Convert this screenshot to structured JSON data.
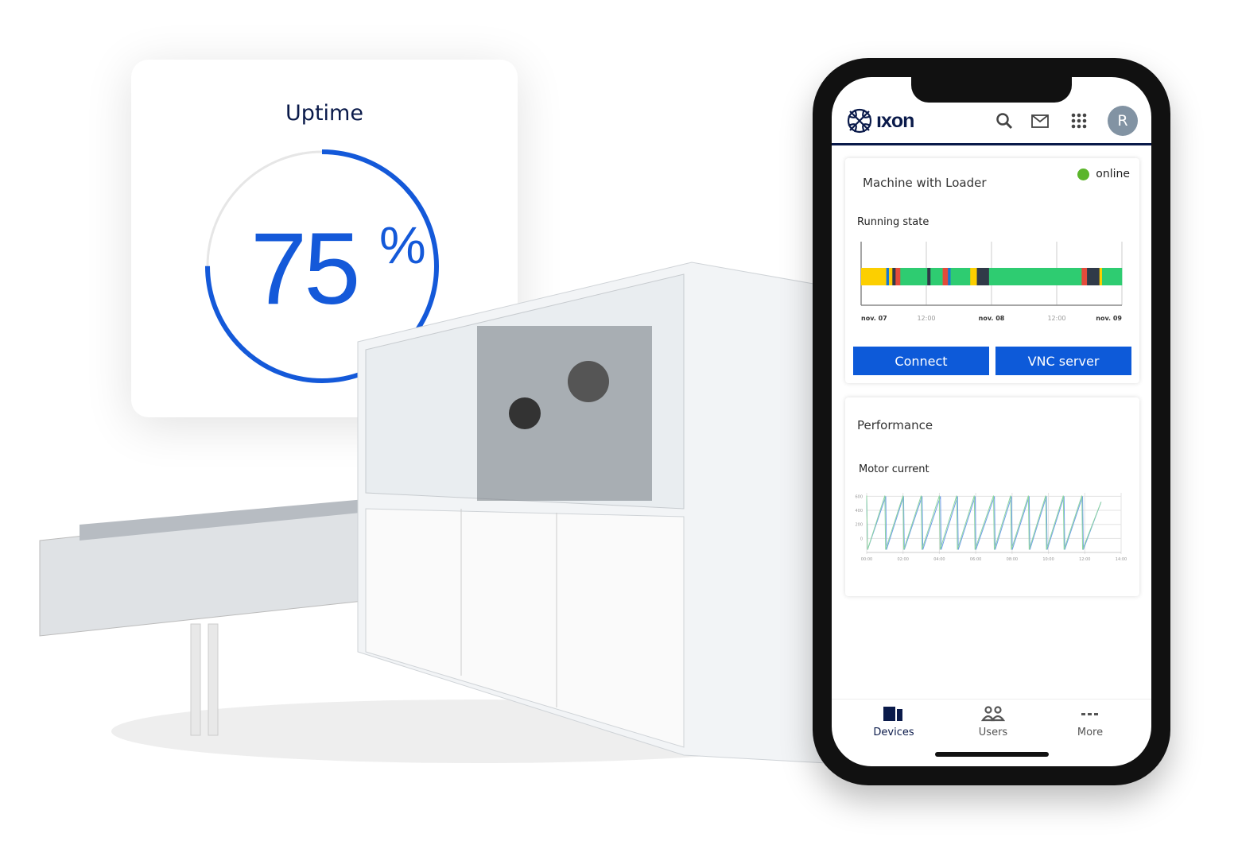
{
  "uptime": {
    "title": "Uptime",
    "value": 75,
    "value_label": "75",
    "unit": "%",
    "color": "#1459d9"
  },
  "app": {
    "brand": "IXON",
    "brand_text": "ıxon",
    "avatar_initial": "R",
    "icons": [
      "search-icon",
      "mail-icon",
      "apps-grid-icon"
    ]
  },
  "device_card": {
    "name": "Machine with Loader",
    "status": "online",
    "status_color": "#5bb52b",
    "section": "Running state",
    "connect_label": "Connect",
    "vnc_label": "VNC server"
  },
  "running_state": {
    "x_labels": [
      "nov. 07",
      "12:00",
      "nov. 08",
      "12:00",
      "nov. 09"
    ],
    "colors": {
      "yellow": "#fccf00",
      "blue": "#1677d2",
      "dark": "#303a48",
      "red": "#e34b3b",
      "green": "#2ecc71"
    },
    "segments_hours": [
      [
        0,
        4.63,
        "yellow"
      ],
      [
        4.63,
        5.12,
        "blue"
      ],
      [
        5.12,
        5.75,
        "yellow"
      ],
      [
        5.75,
        6.34,
        "dark"
      ],
      [
        6.34,
        7.21,
        "red"
      ],
      [
        7.21,
        12.18,
        "green"
      ],
      [
        12.18,
        12.77,
        "dark"
      ],
      [
        12.77,
        15.01,
        "green"
      ],
      [
        15.01,
        15.98,
        "red"
      ],
      [
        15.98,
        16.47,
        "blue"
      ],
      [
        16.47,
        20.08,
        "green"
      ],
      [
        20.08,
        21.3,
        "yellow"
      ],
      [
        21.3,
        23.54,
        "dark"
      ],
      [
        23.54,
        40.59,
        "green"
      ],
      [
        40.59,
        41.57,
        "red"
      ],
      [
        41.57,
        43.86,
        "dark"
      ],
      [
        43.86,
        44.34,
        "yellow"
      ],
      [
        44.34,
        48,
        "green"
      ]
    ]
  },
  "performance_card": {
    "title": "Performance",
    "section": "Motor current"
  },
  "chart_data": {
    "type": "line",
    "y_ticks": [
      "600",
      "400",
      "200",
      "0"
    ],
    "ylim": [
      -200,
      650
    ],
    "x_ticks": [
      "00:00",
      "02:00",
      "04:00",
      "06:00",
      "08:00",
      "10:00",
      "12:00",
      "14:00"
    ],
    "xlim": [
      0,
      14
    ],
    "series": [
      {
        "color": "#6f9de8",
        "cycle_drops_hours": [
          1.05,
          2.03,
          3.05,
          4.06,
          5.0,
          5.97,
          7.03,
          7.97,
          8.94,
          9.89,
          10.86,
          11.88
        ],
        "min": -160,
        "max": 600,
        "end": [
          12.9,
          520
        ]
      },
      {
        "color": "#8fd6a0",
        "cycle_drops_hours": [
          1.0,
          2.0,
          3.0,
          4.0,
          4.95,
          5.92,
          6.98,
          7.92,
          8.9,
          9.85,
          10.82,
          11.84
        ],
        "min": -160,
        "max": 610,
        "end": [
          12.9,
          520
        ]
      }
    ]
  },
  "nav": {
    "items": [
      {
        "label": "Devices",
        "active": true
      },
      {
        "label": "Users"
      },
      {
        "label": "More"
      }
    ]
  }
}
